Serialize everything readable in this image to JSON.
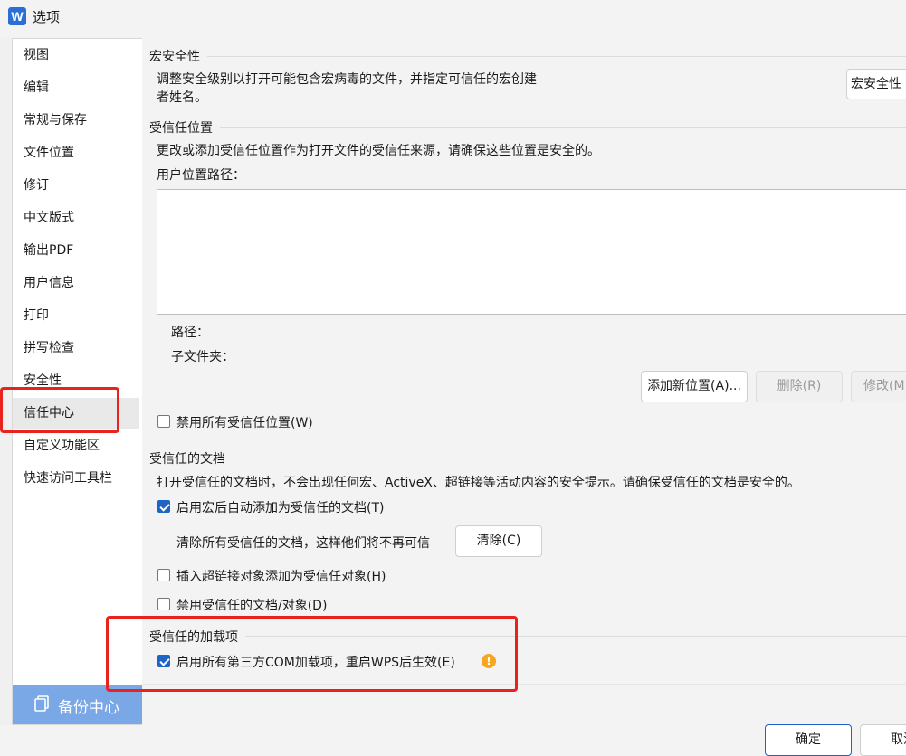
{
  "window": {
    "title": "选项",
    "app_icon_letter": "W"
  },
  "sidebar": {
    "items": [
      "视图",
      "编辑",
      "常规与保存",
      "文件位置",
      "修订",
      "中文版式",
      "输出PDF",
      "用户信息",
      "打印",
      "拼写检查",
      "安全性",
      "信任中心",
      "自定义功能区",
      "快速访问工具栏"
    ],
    "active": "信任中心",
    "backup_label": "备份中心"
  },
  "macro": {
    "title": "宏安全性",
    "desc_line1": "调整安全级别以打开可能包含宏病毒的文件，并指定可信任的宏创建",
    "desc_line2": "者姓名。",
    "button": "宏安全性"
  },
  "locations": {
    "title": "受信任位置",
    "desc": "更改或添加受信任位置作为打开文件的受信任来源，请确保这些位置是安全的。",
    "list_label": "用户位置路径：",
    "path_label": "路径：",
    "subfolder_label": "子文件夹：",
    "add_button": "添加新位置(A)...",
    "delete_button": "删除(R)",
    "modify_button": "修改(M",
    "disable_all": "禁用所有受信任位置(W)"
  },
  "documents": {
    "title": "受信任的文档",
    "desc": "打开受信任的文档时，不会出现任何宏、ActiveX、超链接等活动内容的安全提示。请确保受信任的文档是安全的。",
    "auto_add": "启用宏后自动添加为受信任的文档(T)",
    "clear_text": "清除所有受信任的文档，这样他们将不再可信",
    "clear_button": "清除(C)",
    "hyperlink": "插入超链接对象添加为受信任对象(H)",
    "disable": "禁用受信任的文档/对象(D)"
  },
  "addins": {
    "title": "受信任的加载项",
    "enable_com": "启用所有第三方COM加载项，重启WPS后生效(E)"
  },
  "footer": {
    "ok": "确定",
    "cancel": "取消"
  },
  "colors": {
    "accent": "#1e63c6",
    "highlight": "#e8221c",
    "backup": "#7aa7e6",
    "warning": "#f5a623"
  }
}
